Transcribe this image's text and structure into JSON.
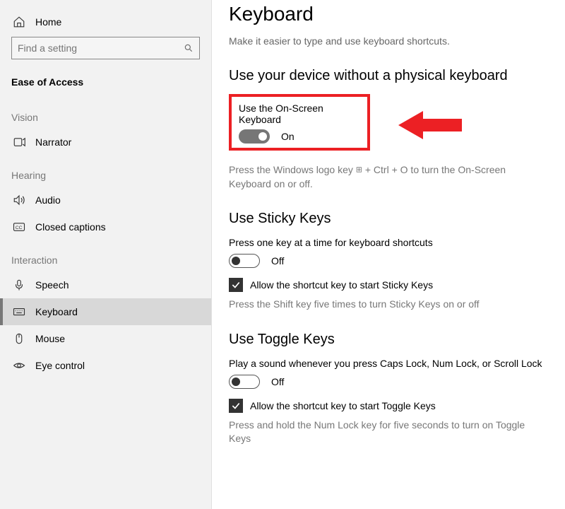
{
  "sidebar": {
    "home_label": "Home",
    "search_placeholder": "Find a setting",
    "section": "Ease of Access",
    "groups": [
      {
        "label": "Vision",
        "items": [
          {
            "id": "narrator",
            "label": "Narrator",
            "icon": "narrator-icon"
          }
        ]
      },
      {
        "label": "Hearing",
        "items": [
          {
            "id": "audio",
            "label": "Audio",
            "icon": "audio-icon"
          },
          {
            "id": "closed-captions",
            "label": "Closed captions",
            "icon": "cc-icon"
          }
        ]
      },
      {
        "label": "Interaction",
        "items": [
          {
            "id": "speech",
            "label": "Speech",
            "icon": "speech-icon"
          },
          {
            "id": "keyboard",
            "label": "Keyboard",
            "icon": "keyboard-icon",
            "active": true
          },
          {
            "id": "mouse",
            "label": "Mouse",
            "icon": "mouse-icon"
          },
          {
            "id": "eye-control",
            "label": "Eye control",
            "icon": "eye-icon"
          }
        ]
      }
    ]
  },
  "main": {
    "title": "Keyboard",
    "intro": "Make it easier to type and use keyboard shortcuts.",
    "osk": {
      "heading": "Use your device without a physical keyboard",
      "label": "Use the On-Screen Keyboard",
      "state": "On",
      "hint_pre": "Press the Windows logo key ",
      "hint_post": " + Ctrl + O to turn the On-Screen Keyboard on or off."
    },
    "sticky": {
      "heading": "Use Sticky Keys",
      "label": "Press one key at a time for keyboard shortcuts",
      "state": "Off",
      "checkbox_label": "Allow the shortcut key to start Sticky Keys",
      "hint": "Press the Shift key five times to turn Sticky Keys on or off"
    },
    "toggle_keys": {
      "heading": "Use Toggle Keys",
      "label": "Play a sound whenever you press Caps Lock, Num Lock, or Scroll Lock",
      "state": "Off",
      "checkbox_label": "Allow the shortcut key to start Toggle Keys",
      "hint": "Press and hold the Num Lock key for five seconds to turn on Toggle Keys"
    }
  }
}
